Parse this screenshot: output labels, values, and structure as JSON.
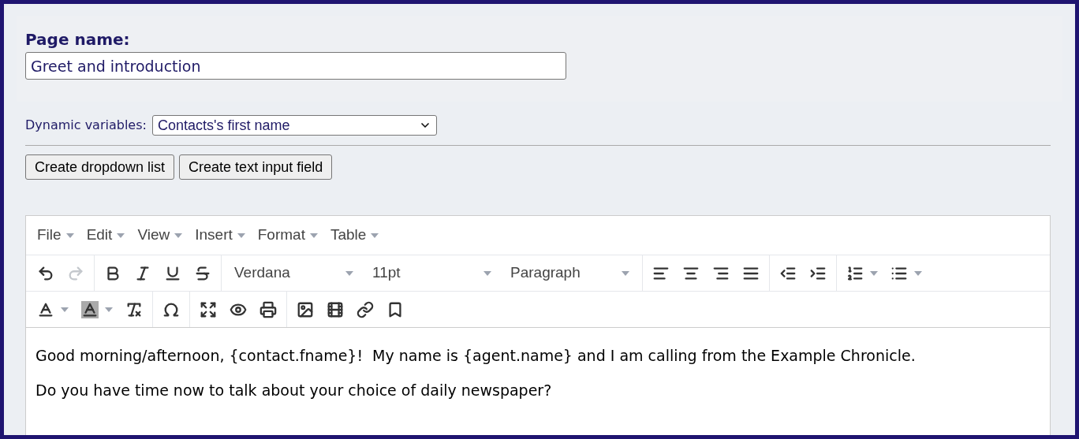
{
  "page_name": {
    "label": "Page name:",
    "value": "Greet and introduction"
  },
  "dynamic_variables": {
    "label": "Dynamic variables:",
    "value": "Contacts's first name"
  },
  "buttons": [
    "Create dropdown list",
    "Create text input field"
  ],
  "editor": {
    "menus": [
      "File",
      "Edit",
      "View",
      "Insert",
      "Format",
      "Table"
    ],
    "history_buttons": [
      {
        "disabled": false
      },
      {
        "disabled": true
      }
    ],
    "font_family": "Verdana",
    "font_size": "11pt",
    "block_format": "Paragraph",
    "content": [
      "Good morning/afternoon, {contact.fname}!  My name is {agent.name} and I am calling from the Example Chronicle.",
      "Do you have time now to talk about your choice of daily newspaper?"
    ]
  }
}
